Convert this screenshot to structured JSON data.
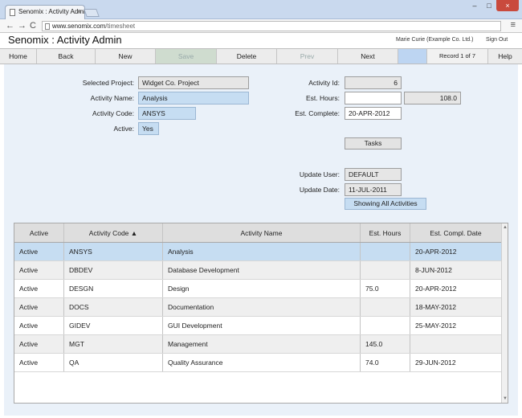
{
  "browser": {
    "tab_title": "Senomix : Activity Admin",
    "tab_close": "×",
    "url_host": "www.senomix.com",
    "url_path": "/timesheet",
    "back": "←",
    "forward": "→",
    "reload": "C",
    "menu": "≡",
    "min": "–",
    "max": "□",
    "close": "×"
  },
  "app": {
    "title": "Senomix : Activity Admin",
    "user": "Marie Curie  (Example Co. Ltd.)",
    "sign_out": "Sign Out"
  },
  "toolbar": {
    "home": "Home",
    "back": "Back",
    "new": "New",
    "save": "Save",
    "delete": "Delete",
    "prev": "Prev",
    "next": "Next",
    "record": "Record 1 of 7",
    "help": "Help"
  },
  "form": {
    "project_label": "Selected Project:",
    "project_value": "Widget Co. Project",
    "name_label": "Activity Name:",
    "name_value": "Analysis",
    "code_label": "Activity Code:",
    "code_value": "ANSYS",
    "active_label": "Active:",
    "active_value": "Yes",
    "id_label": "Activity Id:",
    "id_value": "6",
    "hours_label": "Est. Hours:",
    "hours_input": "",
    "hours_value": "108.0",
    "complete_label": "Est. Complete:",
    "complete_value": "20-APR-2012",
    "tasks_button": "Tasks",
    "update_user_label": "Update User:",
    "update_user_value": "DEFAULT",
    "update_date_label": "Update Date:",
    "update_date_value": "11-JUL-2011",
    "showing_button": "Showing All Activities"
  },
  "grid": {
    "columns": [
      "Active",
      "Activity Code ▲",
      "Activity Name",
      "Est. Hours",
      "Est. Compl. Date"
    ],
    "rows": [
      [
        "Active",
        "ANSYS",
        "Analysis",
        "",
        "20-APR-2012"
      ],
      [
        "Active",
        "DBDEV",
        "Database Development",
        "",
        "8-JUN-2012"
      ],
      [
        "Active",
        "DESGN",
        "Design",
        "75.0",
        "20-APR-2012"
      ],
      [
        "Active",
        "DOCS",
        "Documentation",
        "",
        "18-MAY-2012"
      ],
      [
        "Active",
        "GIDEV",
        "GUI Development",
        "",
        "25-MAY-2012"
      ],
      [
        "Active",
        "MGT",
        "Management",
        "145.0",
        ""
      ],
      [
        "Active",
        "QA",
        "Quality Assurance",
        "74.0",
        "29-JUN-2012"
      ]
    ]
  },
  "colors": {
    "accent": "#c6ddf2",
    "content_bg": "#eaf1f9"
  }
}
